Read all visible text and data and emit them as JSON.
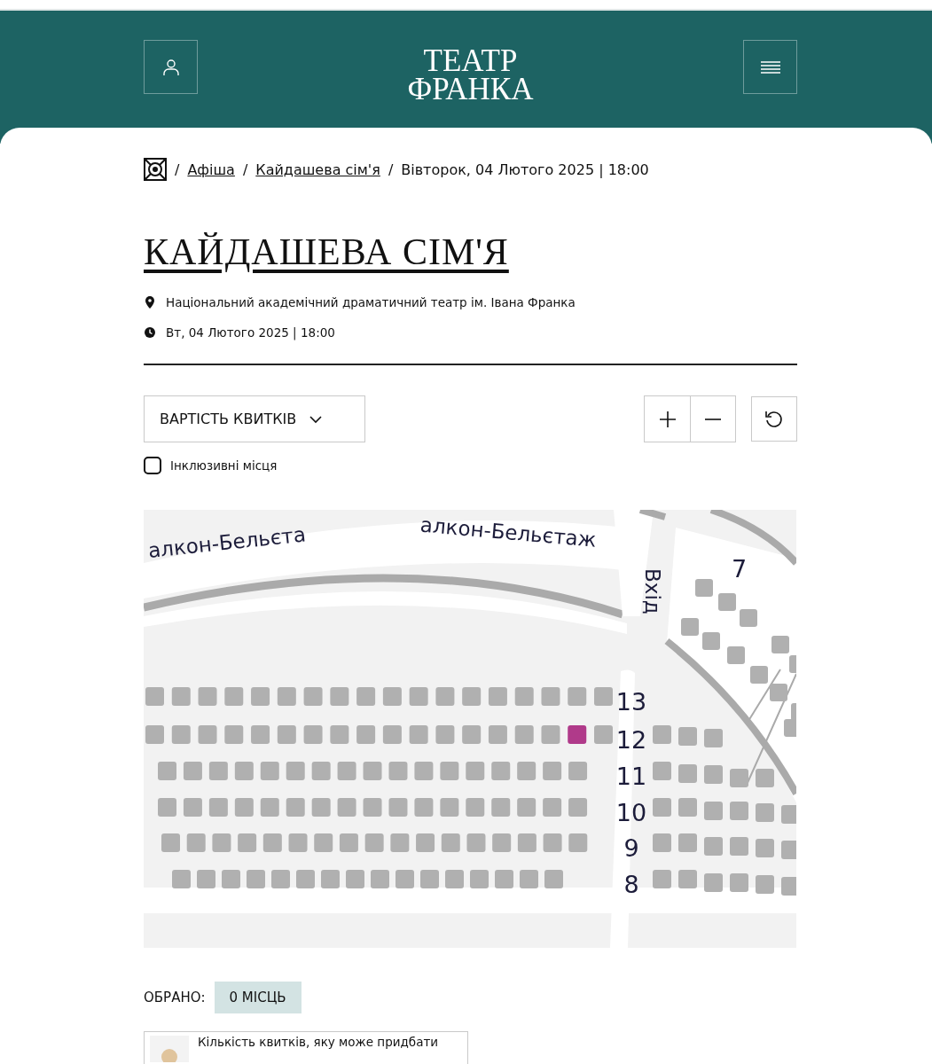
{
  "header": {
    "logo_lines": [
      "ТЕАТР",
      "ФРАНКА"
    ]
  },
  "breadcrumbs": [
    {
      "label": "Афіша",
      "link": true
    },
    {
      "label": "Кайдашева сім'я",
      "link": true
    },
    {
      "label": "Вівторок, 04 Лютого 2025 | 18:00",
      "link": false
    }
  ],
  "breadcrumb_separator": "/",
  "title": "КАЙДАШЕВА СІМ'Я",
  "venue": "Національний академічний драматичний театр ім. Івана Франка",
  "datetime": "Вт, 04 Лютого 2025 | 18:00",
  "price_dropdown": {
    "label": "ВАРТІСТЬ КВИТКІВ",
    "expanded": false
  },
  "inclusive_filter": {
    "label": "Інклюзивні місця",
    "checked": false
  },
  "seat_map": {
    "balcony_labels": [
      "алкон-Бельєта",
      "алкон-Бельєтаж"
    ],
    "entrance_label": "Вхід",
    "side_section": {
      "label": "7",
      "seats": [
        {
          "available": false
        },
        {
          "available": false
        },
        {
          "available": false
        },
        {
          "available": false
        },
        {
          "available": false
        },
        {
          "available": false
        },
        {
          "available": false
        },
        {
          "available": false
        },
        {
          "available": false
        },
        {
          "available": false
        },
        {
          "available": false
        },
        {
          "available": false
        }
      ]
    },
    "rows": [
      {
        "label": "13",
        "left": [
          {
            "available": false
          },
          {
            "available": false
          },
          {
            "available": false
          },
          {
            "available": false
          },
          {
            "available": false
          },
          {
            "available": false
          },
          {
            "available": false
          },
          {
            "available": false
          },
          {
            "available": false
          },
          {
            "available": false
          },
          {
            "available": false
          },
          {
            "available": false
          },
          {
            "available": false
          },
          {
            "available": false
          },
          {
            "available": false
          },
          {
            "available": false
          },
          {
            "available": false
          },
          {
            "available": false
          }
        ],
        "right": []
      },
      {
        "label": "12",
        "left": [
          {
            "available": false
          },
          {
            "available": false
          },
          {
            "available": false
          },
          {
            "available": false
          },
          {
            "available": false
          },
          {
            "available": false
          },
          {
            "available": false
          },
          {
            "available": false
          },
          {
            "available": false
          },
          {
            "available": false
          },
          {
            "available": false
          },
          {
            "available": false
          },
          {
            "available": false
          },
          {
            "available": false
          },
          {
            "available": false
          },
          {
            "available": false
          },
          {
            "available": true
          },
          {
            "available": false
          }
        ],
        "right": [
          {
            "available": false
          },
          {
            "available": false
          },
          {
            "available": false
          }
        ]
      },
      {
        "label": "11",
        "left": [
          {
            "available": false
          },
          {
            "available": false
          },
          {
            "available": false
          },
          {
            "available": false
          },
          {
            "available": false
          },
          {
            "available": false
          },
          {
            "available": false
          },
          {
            "available": false
          },
          {
            "available": false
          },
          {
            "available": false
          },
          {
            "available": false
          },
          {
            "available": false
          },
          {
            "available": false
          },
          {
            "available": false
          },
          {
            "available": false
          },
          {
            "available": false
          },
          {
            "available": false
          }
        ],
        "right": [
          {
            "available": false
          },
          {
            "available": false
          },
          {
            "available": false
          },
          {
            "available": false
          },
          {
            "available": false
          }
        ]
      },
      {
        "label": "10",
        "left": [
          {
            "available": false
          },
          {
            "available": false
          },
          {
            "available": false
          },
          {
            "available": false
          },
          {
            "available": false
          },
          {
            "available": false
          },
          {
            "available": false
          },
          {
            "available": false
          },
          {
            "available": false
          },
          {
            "available": false
          },
          {
            "available": false
          },
          {
            "available": false
          },
          {
            "available": false
          },
          {
            "available": false
          },
          {
            "available": false
          },
          {
            "available": false
          },
          {
            "available": false
          }
        ],
        "right": [
          {
            "available": false
          },
          {
            "available": false
          },
          {
            "available": false
          },
          {
            "available": false
          },
          {
            "available": false
          },
          {
            "available": false
          }
        ]
      },
      {
        "label": "9",
        "left": [
          {
            "available": false
          },
          {
            "available": false
          },
          {
            "available": false
          },
          {
            "available": false
          },
          {
            "available": false
          },
          {
            "available": false
          },
          {
            "available": false
          },
          {
            "available": false
          },
          {
            "available": false
          },
          {
            "available": false
          },
          {
            "available": false
          },
          {
            "available": false
          },
          {
            "available": false
          },
          {
            "available": false
          },
          {
            "available": false
          },
          {
            "available": false
          },
          {
            "available": false
          }
        ],
        "right": [
          {
            "available": false
          },
          {
            "available": false
          },
          {
            "available": false
          },
          {
            "available": false
          },
          {
            "available": false
          },
          {
            "available": false
          }
        ]
      },
      {
        "label": "8",
        "left": [
          {
            "available": false
          },
          {
            "available": false
          },
          {
            "available": false
          },
          {
            "available": false
          },
          {
            "available": false
          },
          {
            "available": false
          },
          {
            "available": false
          },
          {
            "available": false
          },
          {
            "available": false
          },
          {
            "available": false
          },
          {
            "available": false
          },
          {
            "available": false
          },
          {
            "available": false
          },
          {
            "available": false
          },
          {
            "available": false
          },
          {
            "available": false
          }
        ],
        "right": [
          {
            "available": false
          },
          {
            "available": false
          },
          {
            "available": false
          },
          {
            "available": false
          },
          {
            "available": false
          },
          {
            "available": false
          }
        ]
      }
    ]
  },
  "selection": {
    "label": "ОБРАНО:",
    "count": "0 МІСЦЬ"
  },
  "notice": "Кількість квитків, яку може придбати"
}
